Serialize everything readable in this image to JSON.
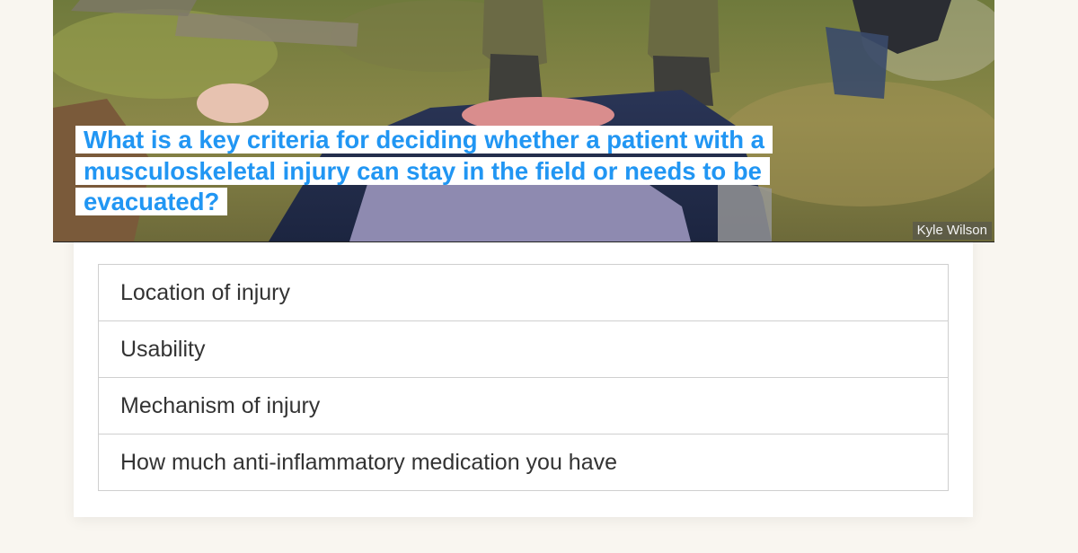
{
  "question": {
    "text": "What is a key criteria for deciding whether a patient with a musculoskeletal injury can stay in the field or needs to be evacuated?",
    "color": "#2196f3"
  },
  "image": {
    "credit": "Kyle Wilson"
  },
  "answers": [
    {
      "label": "Location of injury"
    },
    {
      "label": "Usability"
    },
    {
      "label": "Mechanism of injury"
    },
    {
      "label": "How much anti-inflammatory medication you have"
    }
  ]
}
